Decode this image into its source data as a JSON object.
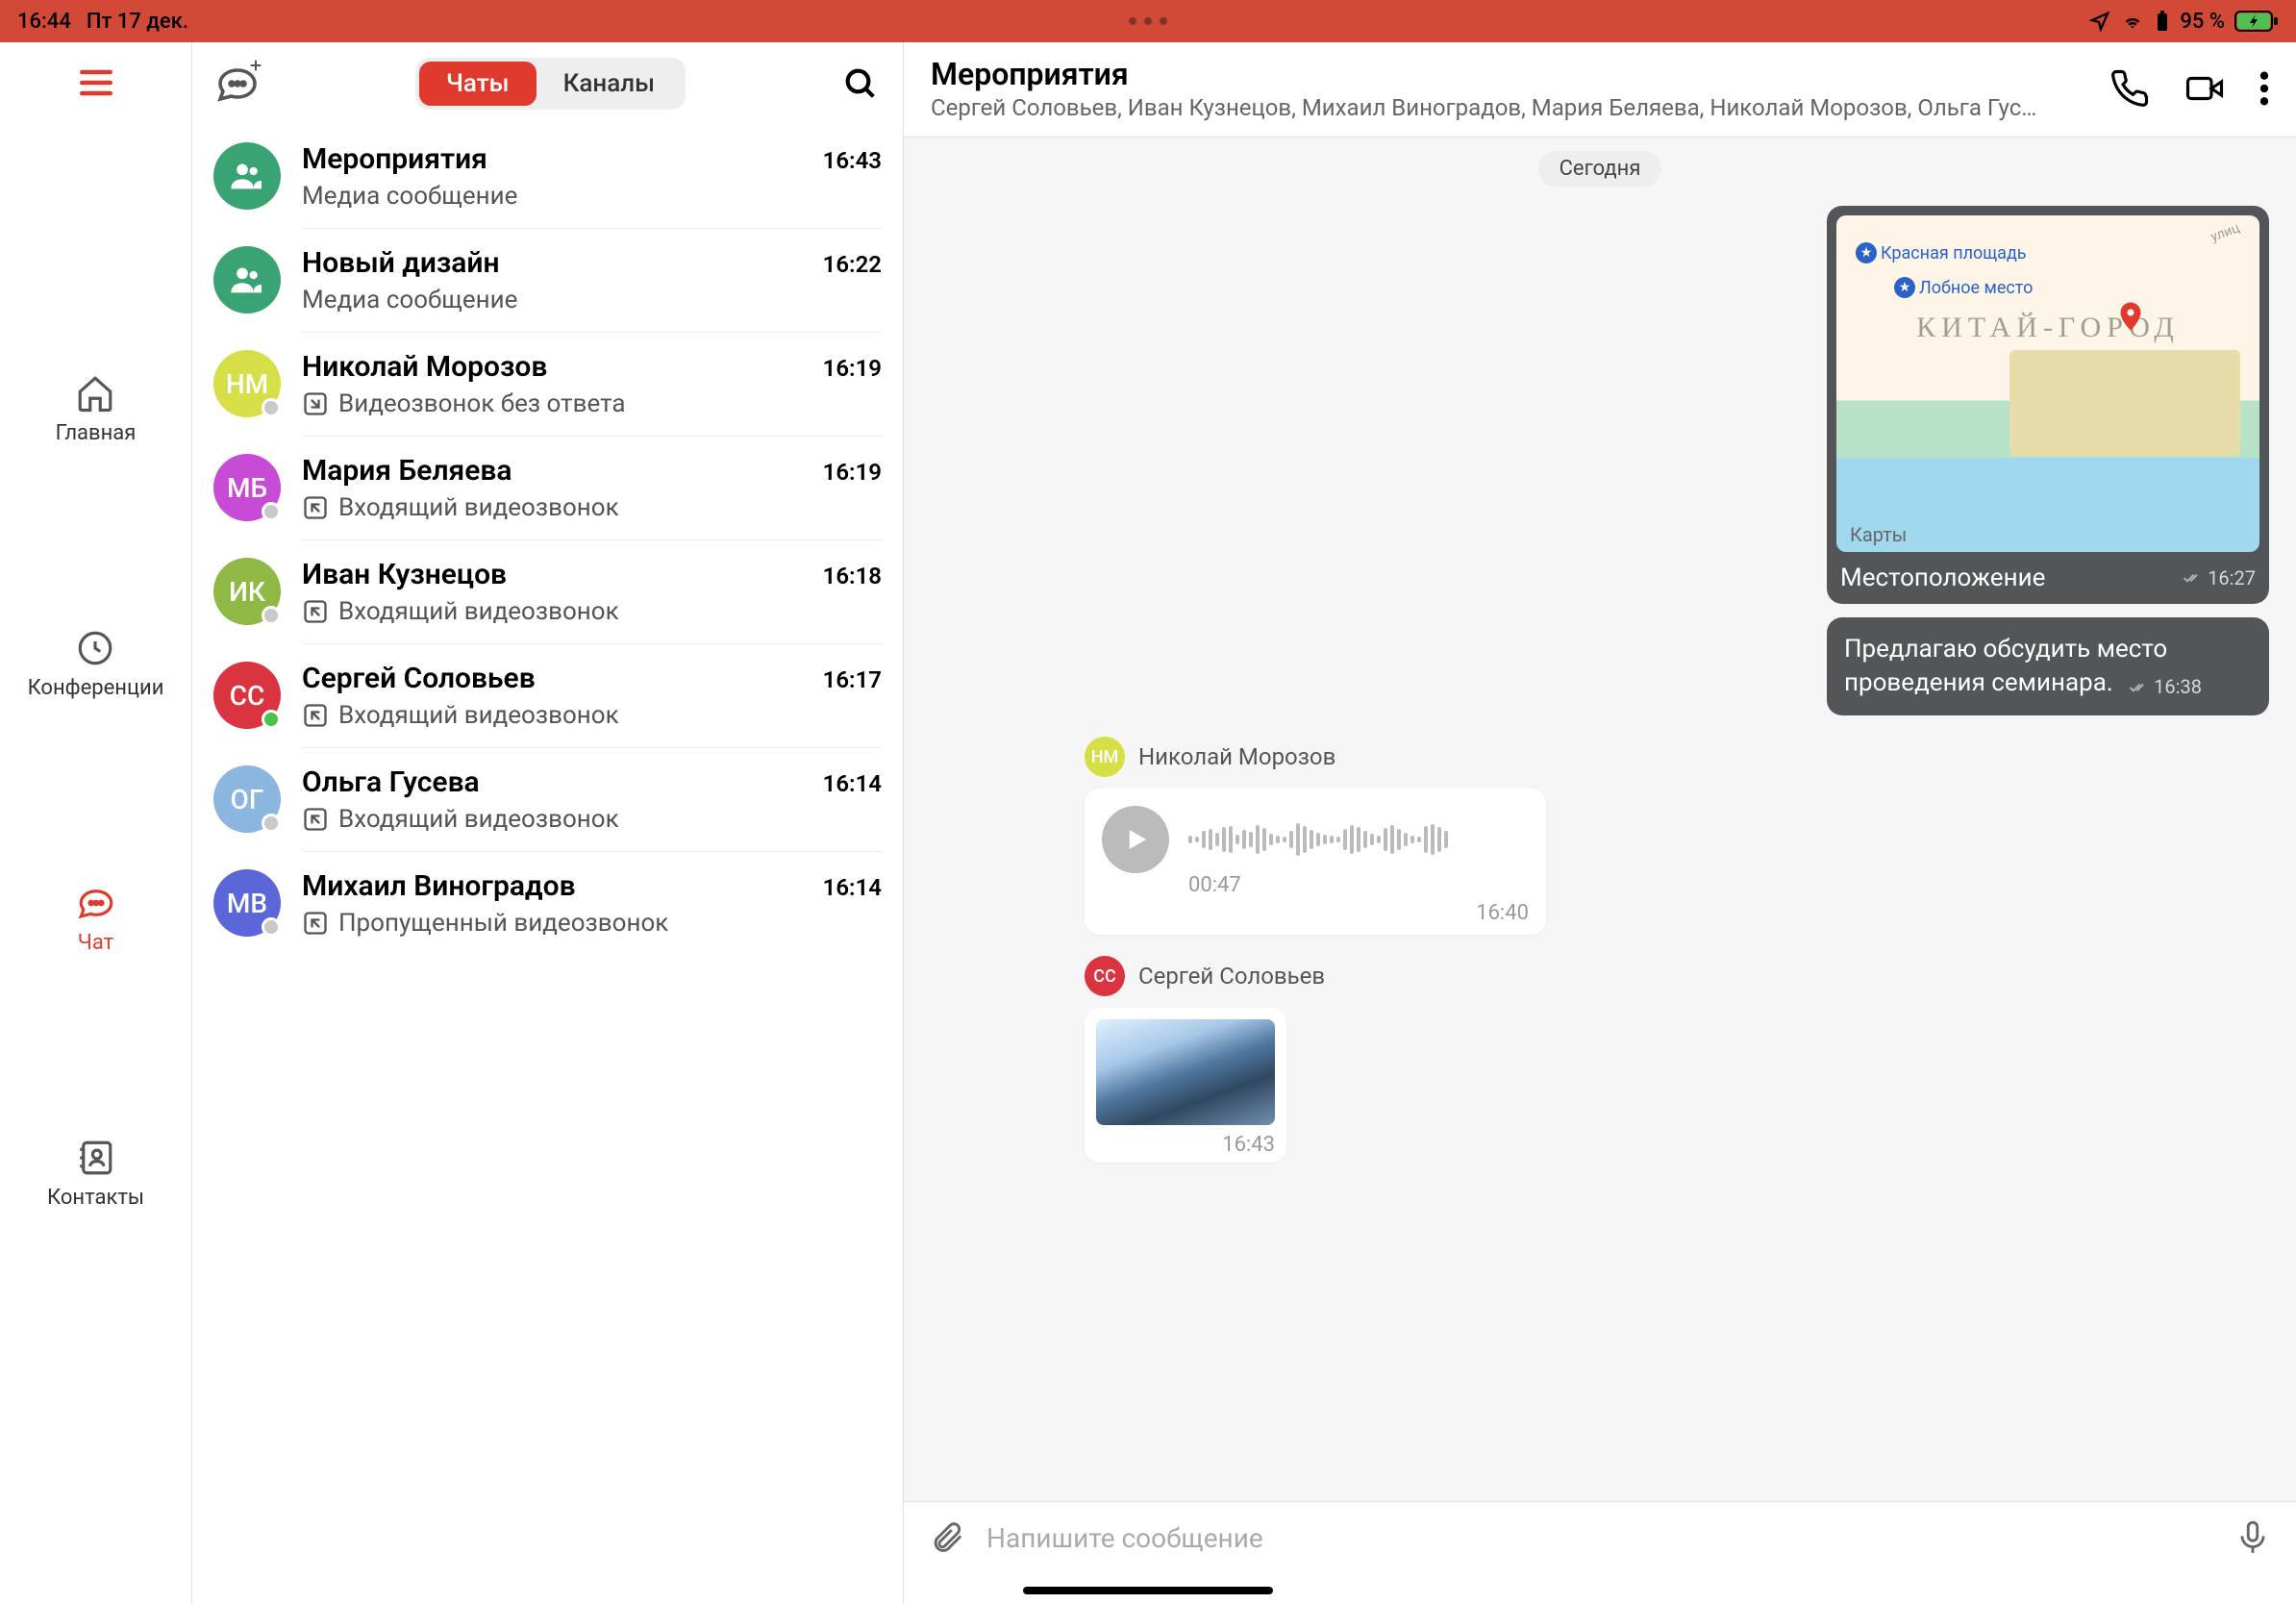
{
  "status": {
    "time": "16:44",
    "date": "Пт 17 дек.",
    "battery": "95 %"
  },
  "sidebar": {
    "items": [
      {
        "label": "Главная"
      },
      {
        "label": "Конференции"
      },
      {
        "label": "Чат"
      },
      {
        "label": "Контакты"
      }
    ]
  },
  "chat_list": {
    "tabs": {
      "chats": "Чаты",
      "channels": "Каналы"
    },
    "rows": [
      {
        "name": "Мероприятия",
        "time": "16:43",
        "sub": "Медиа сообщение",
        "avatar_color": "#3aa373",
        "avatar_type": "group"
      },
      {
        "name": "Новый дизайн",
        "time": "16:22",
        "sub": "Медиа сообщение",
        "avatar_color": "#3aa373",
        "avatar_type": "group"
      },
      {
        "name": "Николай Морозов",
        "time": "16:19",
        "sub": "Видеозвонок без ответа",
        "avatar_color": "#d6de48",
        "initials": "НМ",
        "icon": "out",
        "status": "gray"
      },
      {
        "name": "Мария Беляева",
        "time": "16:19",
        "sub": "Входящий видеозвонок",
        "avatar_color": "#c84bd6",
        "initials": "МБ",
        "icon": "in",
        "status": "gray"
      },
      {
        "name": "Иван Кузнецов",
        "time": "16:18",
        "sub": "Входящий видеозвонок",
        "avatar_color": "#8fb844",
        "initials": "ИК",
        "icon": "in",
        "status": "gray"
      },
      {
        "name": "Сергей Соловьев",
        "time": "16:17",
        "sub": "Входящий видеозвонок",
        "avatar_color": "#d9343f",
        "initials": "СС",
        "icon": "in",
        "status": "green"
      },
      {
        "name": "Ольга Гусева",
        "time": "16:14",
        "sub": "Входящий видеозвонок",
        "avatar_color": "#8ab6e0",
        "initials": "ОГ",
        "icon": "in",
        "status": "gray"
      },
      {
        "name": "Михаил Виноградов",
        "time": "16:14",
        "sub": "Пропущенный видеозвонок",
        "avatar_color": "#5b66d9",
        "initials": "МВ",
        "icon": "in",
        "status": "gray"
      }
    ]
  },
  "conversation": {
    "title": "Мероприятия",
    "subtitle": "Сергей Соловьев, Иван Кузнецов, Михаил Виноградов, Мария Беляева, Николай Морозов, Ольга Гус…",
    "date_chip": "Сегодня",
    "map_msg": {
      "labels": {
        "redsq": "Красная площадь",
        "lobnoe": "Лобное место",
        "district": "КИТАЙ-ГОРОД",
        "attribution": "Карты"
      },
      "caption": "Местоположение",
      "time": "16:27"
    },
    "text_msg": {
      "text": "Предлагаю обсудить место проведения семинара.",
      "time": "16:38"
    },
    "sender1": {
      "name": "Николай Морозов",
      "initials": "НМ",
      "color": "#d6de48"
    },
    "voice": {
      "duration": "00:47",
      "time": "16:40"
    },
    "sender2": {
      "name": "Сергей Соловьев",
      "initials": "СС",
      "color": "#d9343f"
    },
    "image_msg": {
      "time": "16:43"
    }
  },
  "composer": {
    "placeholder": "Напишите сообщение"
  }
}
